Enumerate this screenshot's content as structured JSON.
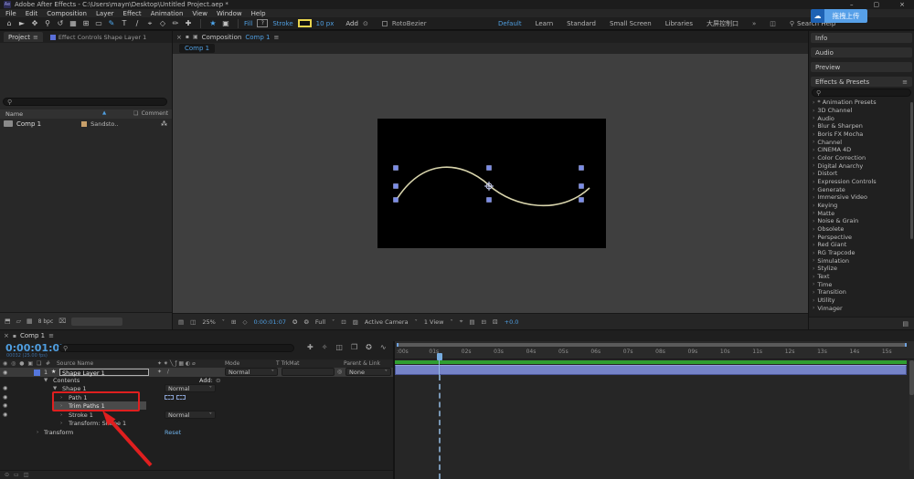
{
  "titlebar": {
    "app_icon": "Ae",
    "title": "Adobe After Effects - C:\\Users\\mayn\\Desktop\\Untitled Project.aep *"
  },
  "icons": {
    "eye": "◉",
    "audio": "◎",
    "solo": "●",
    "lock": "▣",
    "search": "⚲",
    "menu": "≡",
    "close": "×",
    "dropdown": "˅",
    "twirl_open": "▼",
    "twirl_closed": "›",
    "star": "★",
    "add": "⊙",
    "pickwhip": "◎",
    "trash": "⌧",
    "tag": "❏",
    "sort_asc": "▲",
    "cloud": "☁",
    "chevrons": "»",
    "minimize": "–",
    "maximize": "▢",
    "hash": "#",
    "grid": "⊞",
    "mask": "◇",
    "snapshot": "✪",
    "channels": "❂",
    "roi": "⊡",
    "transparency": "▨",
    "comp_item": "▦",
    "flowchart": "⁂",
    "square": "▪",
    "panel_box": "◫"
  },
  "menubar": {
    "items": [
      "File",
      "Edit",
      "Composition",
      "Layer",
      "Effect",
      "Animation",
      "View",
      "Window",
      "Help"
    ]
  },
  "toolbar": {
    "tools": [
      "⌂",
      "►",
      "✥",
      "⚲",
      "↺",
      "▦",
      "⊞",
      "▭",
      "✎",
      "T",
      "∕",
      "⌖",
      "◇",
      "✏",
      "✚"
    ],
    "active_tool_index": 8,
    "star_tool": "★",
    "square_tool": "▣",
    "fill_label": "Fill",
    "fill_value": "?",
    "stroke_label": "Stroke",
    "stroke_width": "10 px",
    "add_label": "Add",
    "rotobezier_label": "RotoBezier"
  },
  "workspace": {
    "items": [
      "Default",
      "Learn",
      "Standard",
      "Small Screen",
      "Libraries",
      "大屏控制口"
    ],
    "active_index": 0,
    "search_label": "Search Help"
  },
  "upload_badge": {
    "label": "拖拽上传"
  },
  "project_panel": {
    "tab": "Project",
    "second_tab": "Effect Controls Shape Layer 1",
    "columns": {
      "name": "Name",
      "comment": "Comment"
    },
    "item": {
      "name": "Comp 1",
      "label_color_name": "Sandsto.."
    },
    "footer": {
      "icons": [
        "⬒",
        "▱",
        "▦"
      ],
      "depth": "8 bpc"
    }
  },
  "viewer": {
    "tab_prefix": "Composition",
    "tab_comp": "Comp 1",
    "subtab": "Comp 1",
    "footer": {
      "zoom": "25%",
      "timecode": "0:00:01:07",
      "resolution": "Full",
      "camera": "Active Camera",
      "view": "1 View",
      "exposure": "+0.0"
    }
  },
  "right_panel": {
    "panels": [
      "Info",
      "Audio",
      "Preview"
    ],
    "effects_title": "Effects & Presets",
    "categories": [
      "* Animation Presets",
      "3D Channel",
      "Audio",
      "Blur & Sharpen",
      "Boris FX Mocha",
      "Channel",
      "CINEMA 4D",
      "Color Correction",
      "Digital Anarchy",
      "Distort",
      "Expression Controls",
      "Generate",
      "Immersive Video",
      "Keying",
      "Matte",
      "Noise & Grain",
      "Obsolete",
      "Perspective",
      "Red Giant",
      "RG Trapcode",
      "Simulation",
      "Stylize",
      "Text",
      "Time",
      "Transition",
      "Utility",
      "Vimager"
    ],
    "footer_icon": "▤"
  },
  "timeline": {
    "tab": "Comp 1",
    "timecode": "0:00:01:07",
    "frame_info": "00032 (25.00 fps)",
    "toolbar_icons": [
      "✚",
      "✧",
      "◫",
      "❒",
      "✪",
      "∿"
    ],
    "columns": {
      "av_icons": "◉ ◎ ● ▣",
      "source_name": "Source Name",
      "switches": "✦ ✷ ╲ ƒ ▦ ◐ ⌀",
      "mode": "Mode",
      "trkmat": "T TrkMat",
      "parent": "Parent & Link"
    },
    "layer": {
      "number": "1",
      "name": "Shape Layer 1",
      "switch_icons": "✦ ∕",
      "mode": "Normal",
      "parent": "None"
    },
    "rows": {
      "contents_label": "Contents",
      "add_label": "Add:",
      "shape1_label": "Shape 1",
      "path1_label": "Path 1",
      "trim_label": "Trim Paths 1",
      "stroke1_label": "Stroke 1",
      "transform_shape_label": "Transform: Shape 1",
      "transform_label": "Transform",
      "reset_label": "Reset",
      "mode_normal": "Normal"
    },
    "ruler_ticks": [
      ":00s",
      "01s",
      "02s",
      "03s",
      "04s",
      "05s",
      "06s",
      "07s",
      "08s",
      "09s",
      "10s",
      "11s",
      "12s",
      "13s",
      "14s",
      "15s"
    ]
  },
  "colors": {
    "accent_blue": "#4f9ee0",
    "link_blue": "#6fb1e8",
    "layer_bar": "#7583c8",
    "render_bar_green": "#2f9e30",
    "annotation_red": "#df1f1f",
    "stroke_swatch_yellow": "#e8d44d",
    "label_sandstone": "#c8a06a",
    "layer_swatch_blue": "#5577dd"
  }
}
